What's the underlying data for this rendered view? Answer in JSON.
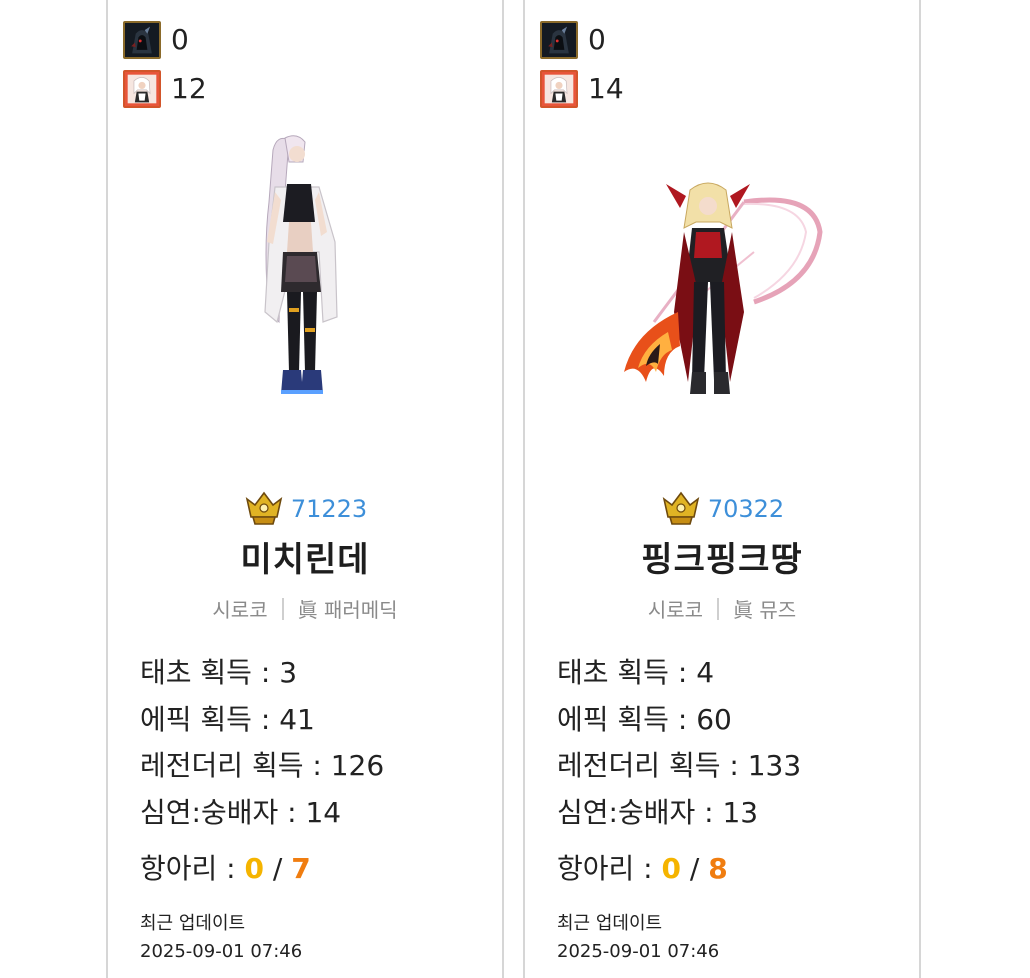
{
  "cards": [
    {
      "counters": [
        {
          "icon": "dark-hood-icon",
          "value": "0"
        },
        {
          "icon": "white-hair-portrait-icon",
          "value": "12"
        }
      ],
      "avatar": "white-haired-fighter-sprite",
      "fame": "71223",
      "name": "미치린데",
      "server": "시로코",
      "job": "眞 패러메딕",
      "stats": {
        "taecho": {
          "label": "태초 획득 : ",
          "value": "3"
        },
        "epic": {
          "label": "에픽 획득 : ",
          "value": "41"
        },
        "legendary": {
          "label": "레전더리 획득 : ",
          "value": "126"
        },
        "abyss": {
          "label": "심연:숭배자 : ",
          "value": "14"
        },
        "hang": {
          "label": "항아리 : ",
          "done": "0",
          "sep": " / ",
          "total": "7"
        }
      },
      "updated_label": "최근 업데이트",
      "updated_time": "2025-09-01 07:46"
    },
    {
      "counters": [
        {
          "icon": "dark-hood-icon",
          "value": "0"
        },
        {
          "icon": "white-hair-portrait-icon",
          "value": "14"
        }
      ],
      "avatar": "blonde-archer-sprite",
      "fame": "70322",
      "name": "핑크핑크땅",
      "server": "시로코",
      "job": "眞 뮤즈",
      "stats": {
        "taecho": {
          "label": "태초 획득 : ",
          "value": "4"
        },
        "epic": {
          "label": "에픽 획득 : ",
          "value": "60"
        },
        "legendary": {
          "label": "레전더리 획득 : ",
          "value": "133"
        },
        "abyss": {
          "label": "심연:숭배자 : ",
          "value": "13"
        },
        "hang": {
          "label": "항아리 : ",
          "done": "0",
          "sep": " / ",
          "total": "8"
        }
      },
      "updated_label": "최근 업데이트",
      "updated_time": "2025-09-01 07:46"
    }
  ],
  "colors": {
    "fame": "#3d8fd9",
    "hang_done": "#f5b400",
    "hang_total": "#f07d10",
    "card_border": "#d6d6d6",
    "meta_text": "#8a8a8a"
  }
}
